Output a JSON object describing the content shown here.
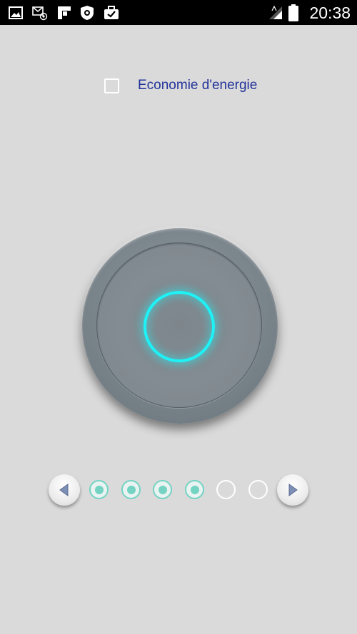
{
  "status_bar": {
    "time": "20:38",
    "left_icons": [
      "image-icon",
      "mail-at-icon",
      "flipboard-icon",
      "shield-icon",
      "briefcase-check-icon"
    ],
    "right_icons": [
      "wifi-signal-icon",
      "cell-signal-icon",
      "battery-icon"
    ]
  },
  "settings": {
    "energy_saving_label": "Economie d'energie",
    "energy_saving_checked": false
  },
  "power_button": {
    "icon": "power-ring-icon",
    "glow_color": "#1ef2f6"
  },
  "level_selector": {
    "total": 6,
    "active": 4,
    "active_color": "#74d3c3",
    "prev_icon": "triangle-left-icon",
    "next_icon": "triangle-right-icon"
  }
}
